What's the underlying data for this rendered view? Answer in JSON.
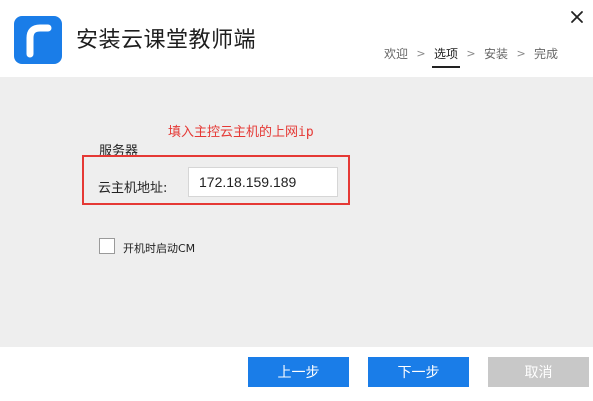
{
  "window": {
    "title": "安装云课堂教师端",
    "close_icon": "close-icon"
  },
  "logo": {
    "icon": "app-logo-icon",
    "color": "#1a7de8"
  },
  "steps": {
    "items": [
      "欢迎",
      "选项",
      "安装",
      "完成"
    ],
    "active_index": 1,
    "separator": ">"
  },
  "content": {
    "hint": "填入主控云主机的上网ip",
    "group_title": "服务器",
    "host_label": "云主机地址:",
    "host_value": "172.18.159.189",
    "autostart_label": "开机时启动CM",
    "autostart_checked": false
  },
  "footer": {
    "prev_label": "上一步",
    "next_label": "下一步",
    "cancel_label": "取消"
  },
  "colors": {
    "accent": "#1a7de8",
    "annotation": "#e53935",
    "disabled": "#c8c8c8"
  }
}
